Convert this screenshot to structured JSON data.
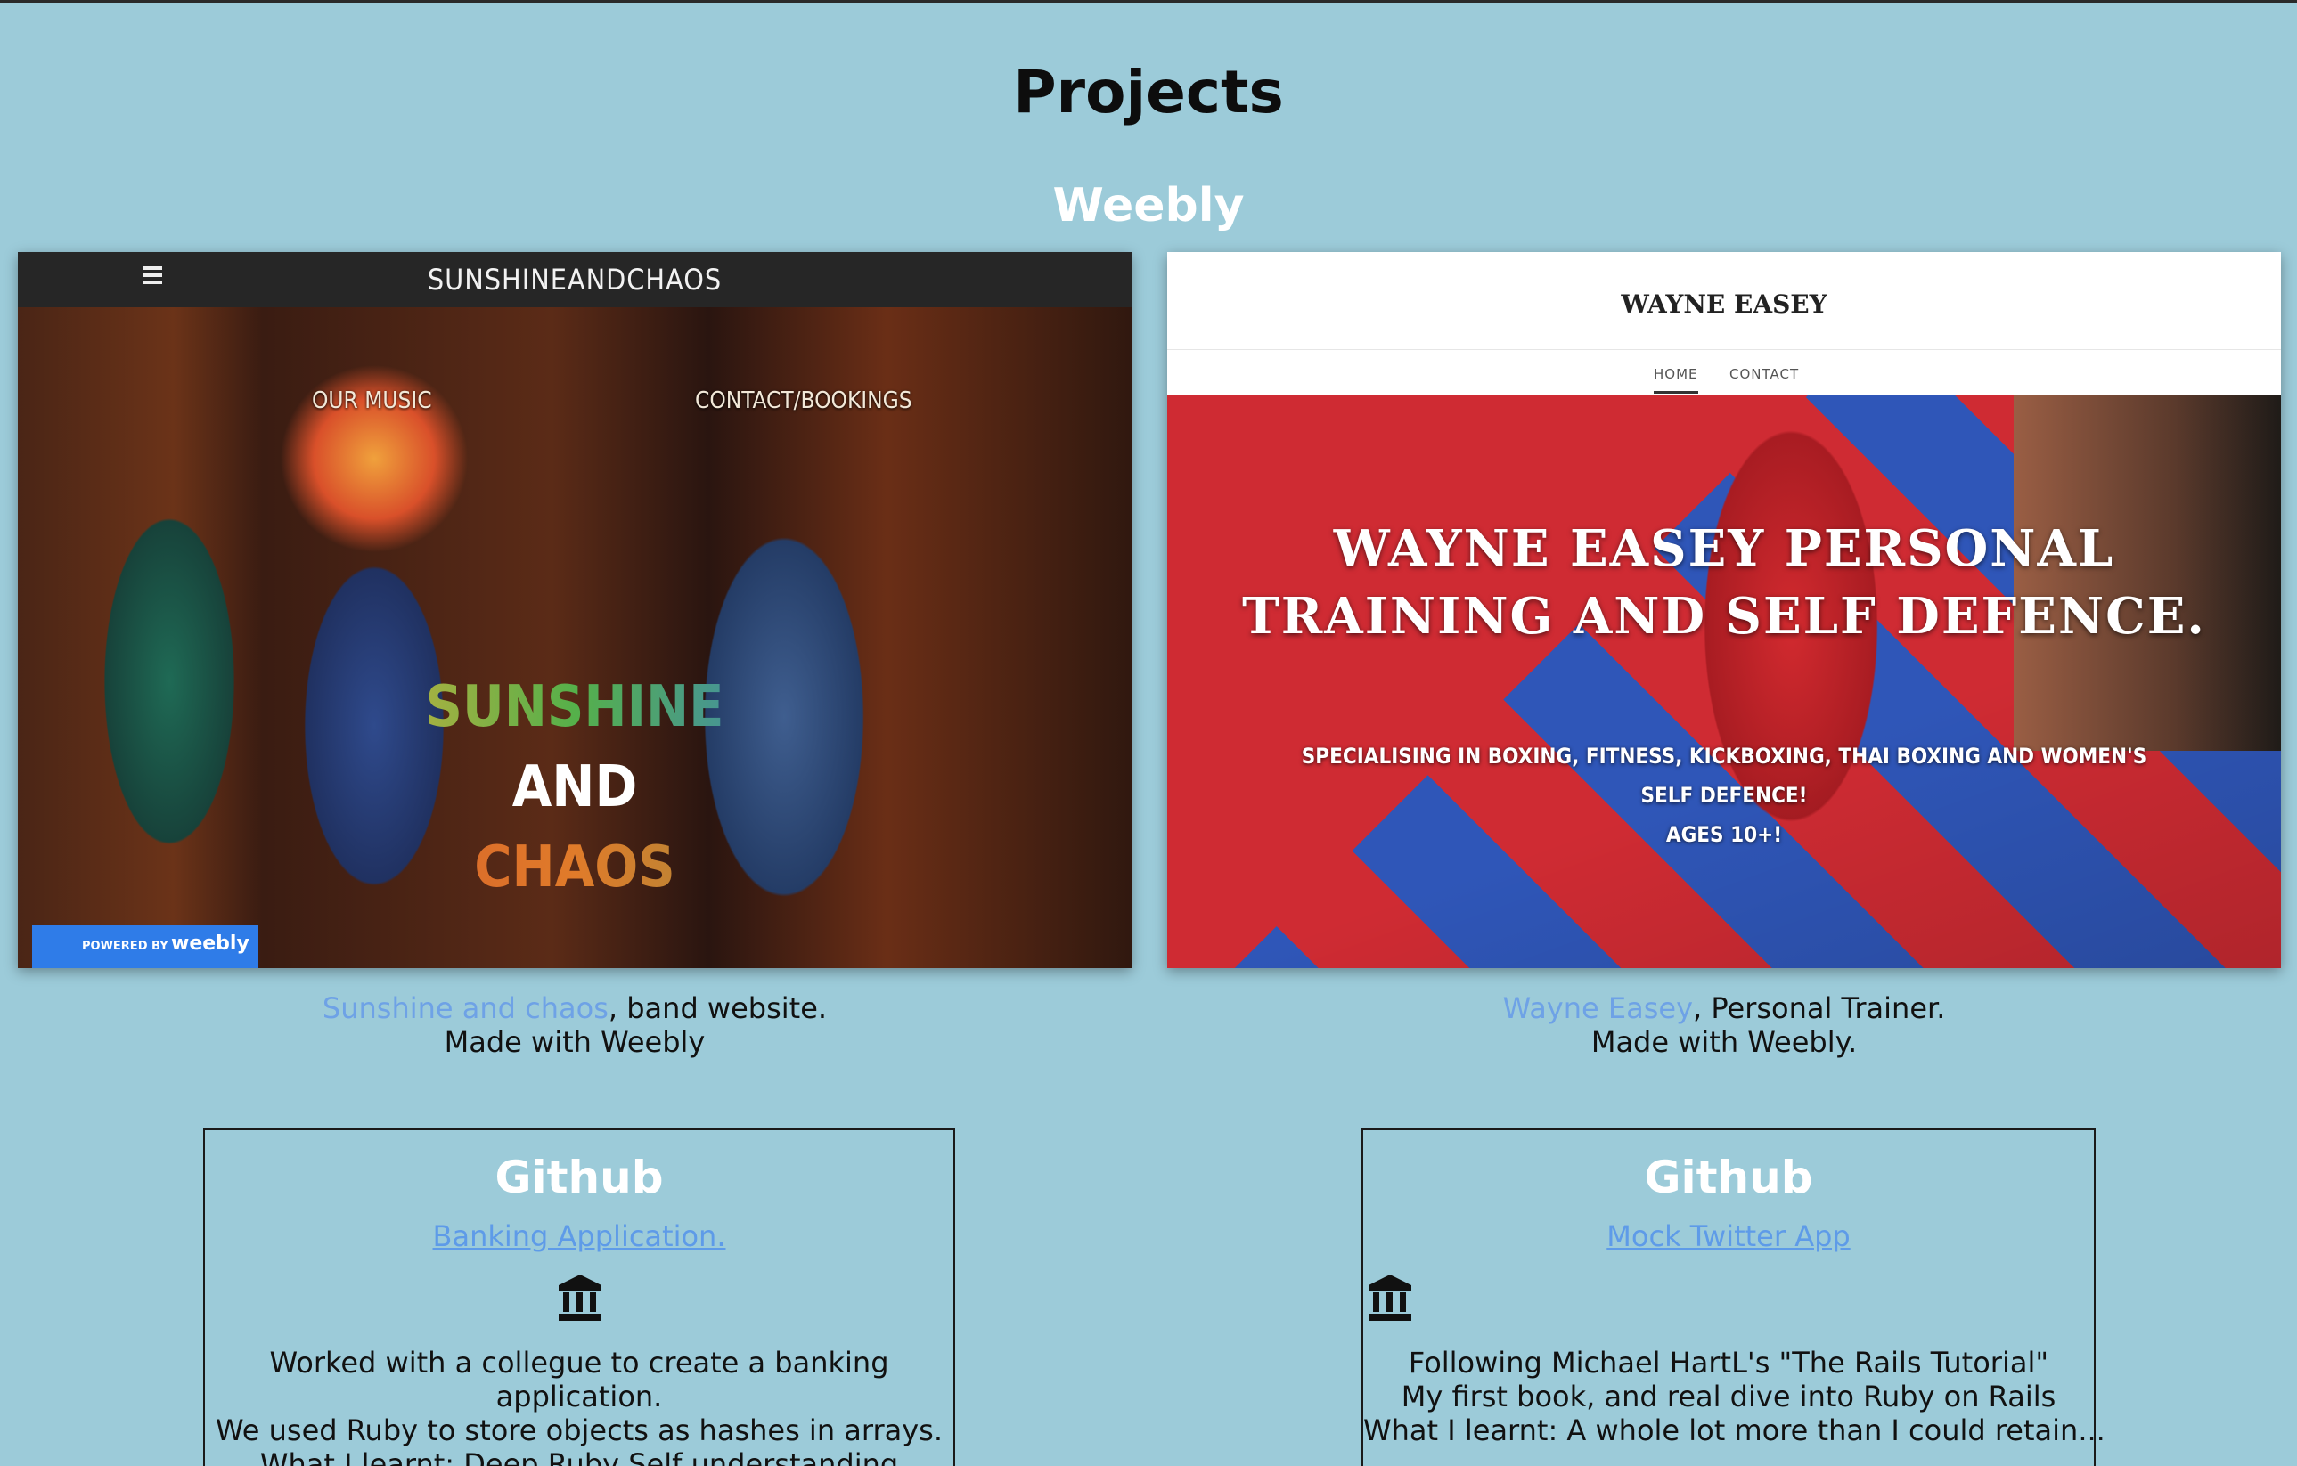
{
  "page": {
    "title": "Projects"
  },
  "weebly_section": {
    "title": "Weebly"
  },
  "project_band": {
    "screenshot": {
      "brand": "SUNSHINEANDCHAOS",
      "nav_our_music": "OUR MUSIC",
      "nav_contact": "CONTACT/BOOKINGS",
      "hero_line1": "SUNSHINE",
      "hero_line2": "AND",
      "hero_line3": "CHAOS",
      "badge_small": "POWERED BY",
      "badge_big": "weebly"
    },
    "link_text": "Sunshine and chaos",
    "caption_rest": ", band website.",
    "caption_line2": "Made with Weebly"
  },
  "project_trainer": {
    "screenshot": {
      "site_name": "WAYNE EASEY",
      "nav_home": "HOME",
      "nav_contact": "CONTACT",
      "hero_title_line1": "WAYNE EASEY PERSONAL",
      "hero_title_line2": "TRAINING AND SELF DEFENCE.",
      "hero_sub_line1": "SPECIALISING IN BOXING, FITNESS, KICKBOXING, THAI BOXING AND WOMEN'S",
      "hero_sub_line2": "SELF DEFENCE!",
      "hero_sub_line3": "AGES 10+!"
    },
    "link_text": "Wayne Easey",
    "caption_rest": ", Personal Trainer.",
    "caption_line2": "Made with Weebly."
  },
  "github_banking": {
    "title": "Github",
    "link_text": "Banking Application.",
    "icon": "bank-icon",
    "desc_line1": "Worked with a collegue to create a banking",
    "desc_line2": "application.",
    "desc_line3": "We used Ruby to store objects as hashes in arrays.",
    "desc_line4": "What I learnt: Deep Ruby Self understanding"
  },
  "github_twitter": {
    "title": "Github",
    "link_text": "Mock Twitter App",
    "icon": "bank-icon",
    "desc_line1": "Following Michael HartL's \"The Rails Tutorial\"",
    "desc_line2": "My first book, and real dive into Ruby on Rails",
    "desc_line3": "What I learnt: A whole lot more than I could retain..."
  },
  "colors": {
    "background": "#9ccbd9",
    "link": "#6ea2e6",
    "heading_white": "#ffffff",
    "weebly_badge": "#2f7ce8"
  }
}
